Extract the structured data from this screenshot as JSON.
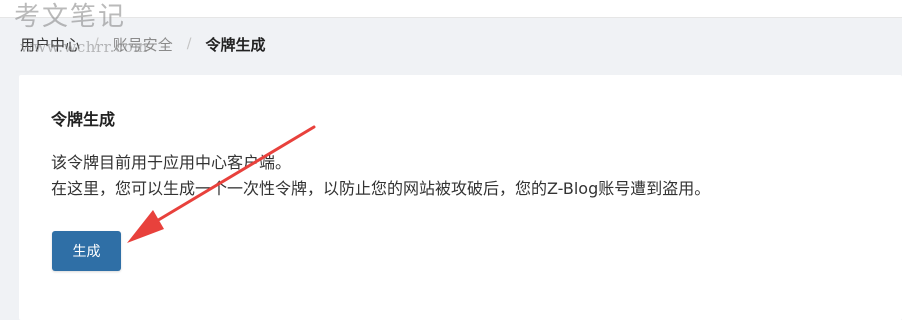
{
  "watermark": {
    "title": "考文笔记",
    "url": "www.wchrr.com"
  },
  "breadcrumb": {
    "items": [
      "用户中心",
      "账号安全",
      "令牌生成"
    ],
    "separator": "/"
  },
  "card": {
    "title": "令牌生成",
    "desc_line1": "该令牌目前用于应用中心客户端。",
    "desc_line2": "在这里，您可以生成一个一次性令牌，以防止您的网站被攻破后，您的Z-Blog账号遭到盗用。",
    "button_label": "生成"
  },
  "colors": {
    "button": "#2f6fa6",
    "arrow": "#e8413c",
    "background": "#f0f2f5"
  }
}
